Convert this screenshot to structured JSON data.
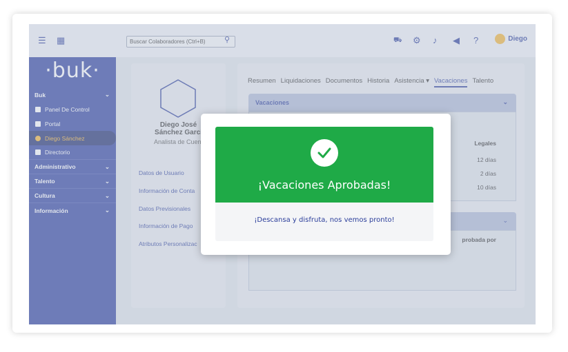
{
  "topbar": {
    "search_placeholder": "Buscar Colaboradores (Ctrl+B)",
    "user_name": "Diego"
  },
  "sidebar": {
    "logo": "·buk·",
    "sections": [
      {
        "label": "Buk",
        "items": [
          "Panel De Control",
          "Portal",
          "Diego Sánchez",
          "Directorio"
        ]
      },
      {
        "label": "Administrativo"
      },
      {
        "label": "Talento"
      },
      {
        "label": "Cultura"
      },
      {
        "label": "Información"
      }
    ]
  },
  "profile": {
    "name_line1": "Diego José",
    "name_line2": "Sánchez Garcí",
    "role": "Analista de Cuent",
    "links": [
      "Datos de Usuario",
      "Información de Conta",
      "Datos Previsionales",
      "Información de Pago",
      "Atributos Personalizac"
    ]
  },
  "tabs": [
    "Resumen",
    "Liquidaciones",
    "Documentos",
    "Historia",
    "Asistencia ▾",
    "Vacaciones",
    "Talento"
  ],
  "vacaciones": {
    "title": "Vacaciones",
    "legales_header": "Legales",
    "values": [
      "12 días",
      "2 días",
      "10 días"
    ]
  },
  "historial": {
    "partial_text": "probada por"
  },
  "modal": {
    "title": "¡Vacaciones Aprobadas!",
    "subtitle": "¡Descansa y disfruta, nos vemos pronto!"
  },
  "colors": {
    "sidebar": "#2d3f9e",
    "accent": "#f2b233",
    "success": "#1faa47"
  }
}
